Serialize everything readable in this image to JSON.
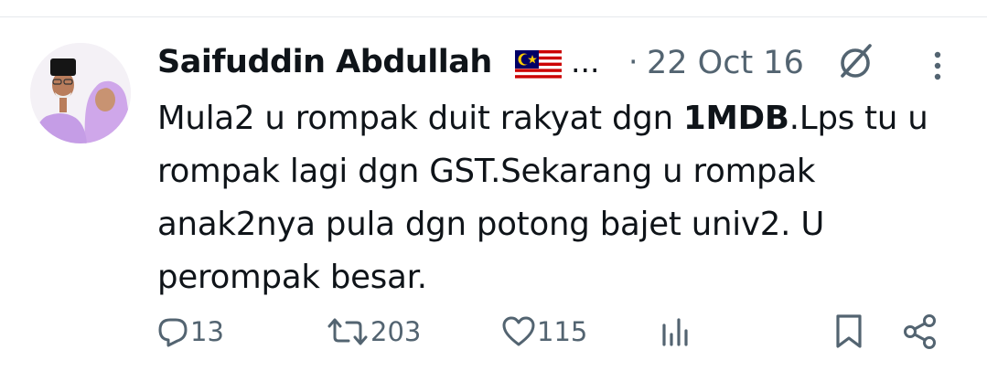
{
  "tweet": {
    "author_name": "Saifuddin Abdullah",
    "author_flag": "malaysia-flag",
    "truncation": "...",
    "separator": "·",
    "date": "22 Oct 16",
    "text_before": "Mula2 u rompak duit rakyat dgn ",
    "text_highlight": "1MDB",
    "text_after": ".Lps tu u rompak lagi dgn GST.Sekarang u rompak anak2nya pula dgn potong bajet univ2. U perompak besar."
  },
  "actions": {
    "replies": "13",
    "retweets": "203",
    "likes": "115"
  },
  "colors": {
    "text": "#0f1419",
    "secondary": "#536471",
    "avatar_clothing": "#c9a3e6"
  }
}
